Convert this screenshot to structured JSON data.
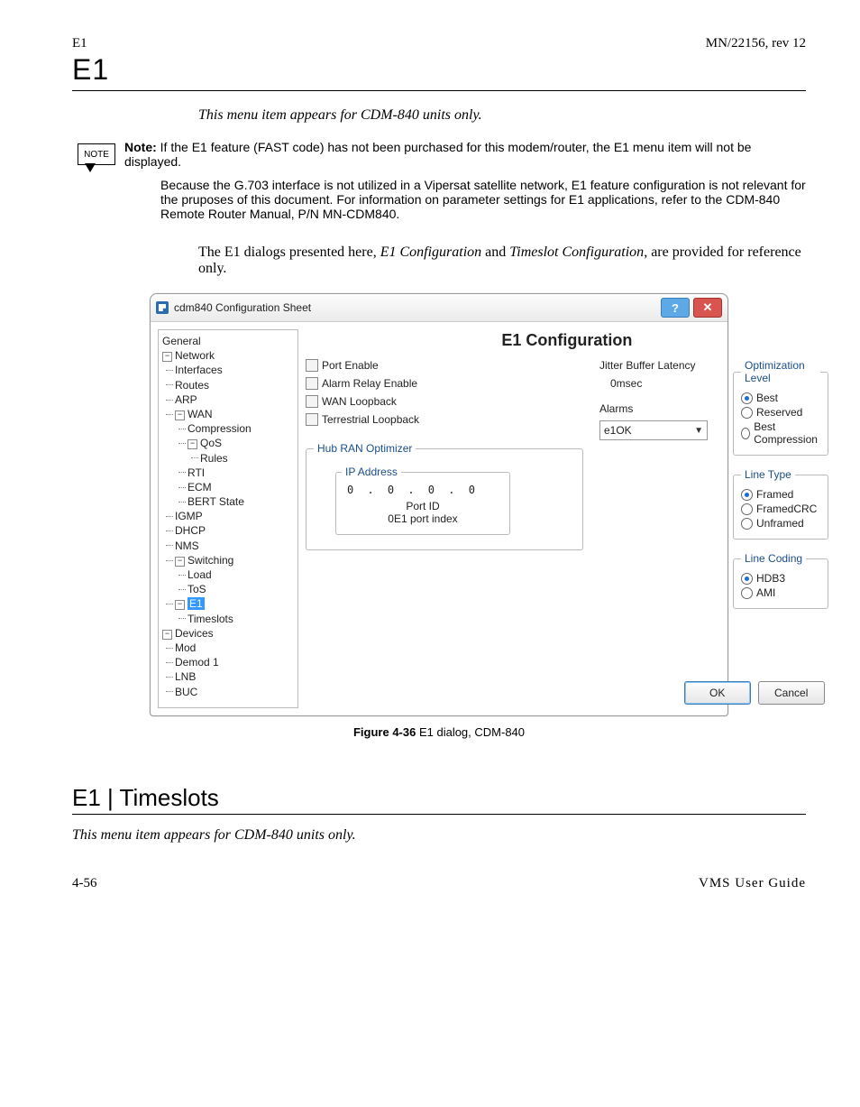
{
  "page": {
    "header_left": "E1",
    "header_right": "MN/22156, rev 12",
    "big_e1": "E1"
  },
  "intro_italic": "This menu item appears for CDM-840 units only.",
  "note": {
    "icon_label": "NOTE",
    "label": "Note:",
    "p1": "If the E1 feature (FAST code) has not been purchased for this modem/router, the E1 menu item will not be displayed.",
    "p2": "Because the G.703 interface is not utilized in a Vipersat satellite network, E1 feature configuration is not relevant for the pruposes of this document. For information on parameter settings for E1 applications, refer to the CDM-840 Remote Router Manual, P/N MN-CDM840."
  },
  "para_after_note_1": "The E1 dialogs presented here, ",
  "para_after_note_em1": "E1 Configuration",
  "para_after_note_2": " and ",
  "para_after_note_em2": "Timeslot Configuration",
  "para_after_note_3": ", are provided for reference only.",
  "dialog": {
    "title": "cdm840 Configuration Sheet",
    "help_glyph": "?",
    "close_glyph": "✕",
    "tree": {
      "general": "General",
      "network": "Network",
      "interfaces": "Interfaces",
      "routes": "Routes",
      "arp": "ARP",
      "wan": "WAN",
      "compression": "Compression",
      "qos": "QoS",
      "rules": "Rules",
      "rti": "RTI",
      "ecm": "ECM",
      "bert": "BERT State",
      "igmp": "IGMP",
      "dhcp": "DHCP",
      "nms": "NMS",
      "switching": "Switching",
      "load": "Load",
      "tos": "ToS",
      "e1": "E1",
      "timeslots": "Timeslots",
      "devices": "Devices",
      "mod": "Mod",
      "demod1": "Demod 1",
      "lnb": "LNB",
      "buc": "BUC"
    },
    "heading": "E1 Configuration",
    "checks": {
      "port_enable": "Port Enable",
      "alarm_relay": "Alarm Relay Enable",
      "wan_loopback": "WAN Loopback",
      "terr_loopback": "Terrestrial Loopback"
    },
    "mid": {
      "jitter_label": "Jitter Buffer Latency",
      "jitter_value": "0msec",
      "alarms_label": "Alarms",
      "alarms_value": "e1OK"
    },
    "opt": {
      "legend": "Optimization Level",
      "best": "Best",
      "reserved": "Reserved",
      "best_comp": "Best Compression"
    },
    "linetype": {
      "legend": "Line Type",
      "framed": "Framed",
      "framedcrc": "FramedCRC",
      "unframed": "Unframed"
    },
    "linecoding": {
      "legend": "Line Coding",
      "hdb3": "HDB3",
      "ami": "AMI"
    },
    "hub": {
      "legend": "Hub RAN Optimizer",
      "ip_label": "IP Address",
      "ip_value": "0   .   0   .   0   .   0",
      "port_label": "Port ID",
      "port_value": "0E1 port index"
    },
    "buttons": {
      "ok": "OK",
      "cancel": "Cancel"
    }
  },
  "figure_caption_bold": "Figure 4-36",
  "figure_caption_rest": "   E1 dialog, CDM-840",
  "section2": {
    "heading": "E1 | Timeslots",
    "italic": "This menu item appears for CDM-840 units only."
  },
  "footer": {
    "left": "4-56",
    "right": "VMS User Guide"
  }
}
